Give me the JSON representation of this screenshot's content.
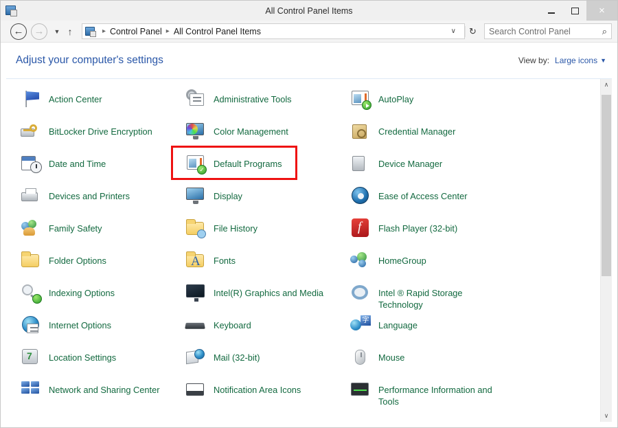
{
  "window": {
    "title": "All Control Panel Items",
    "icon": "control-panel-icon",
    "controls": {
      "minimize": "–",
      "maximize": "□",
      "close": "×"
    }
  },
  "addressbar": {
    "back_icon": "←",
    "forward_icon": "→",
    "history_caret": "▼",
    "up_icon": "↑",
    "crumb_icon": "control-panel-icon",
    "separator": "▸",
    "crumbs": [
      "Control Panel",
      "All Control Panel Items"
    ],
    "dropdown_caret": "∨",
    "refresh_icon": "↻",
    "search": {
      "value": "",
      "placeholder": "Search Control Panel",
      "icon": "⌕"
    }
  },
  "header": {
    "page_title": "Adjust your computer's settings",
    "viewby_label": "View by:",
    "viewby_value": "Large icons",
    "viewby_caret": "▼"
  },
  "highlight": {
    "target": "Default Programs",
    "color": "#ee1111"
  },
  "colors": {
    "item_label": "#12693f",
    "page_title": "#2a57a8",
    "link": "#2a57a8",
    "titlebar_bg": "#f0f0f0",
    "highlight_red": "#ee1111"
  },
  "scrollbar": {
    "up_arrow": "∧",
    "down_arrow": "∨"
  },
  "items": [
    {
      "label": "Action Center",
      "icon": "action-center-icon",
      "art": "action-center"
    },
    {
      "label": "Administrative Tools",
      "icon": "administrative-tools-icon",
      "art": "administrative-tools"
    },
    {
      "label": "AutoPlay",
      "icon": "autoplay-icon",
      "art": "autoplay"
    },
    {
      "label": "BitLocker Drive Encryption",
      "icon": "bitlocker-icon",
      "art": "bitlocker"
    },
    {
      "label": "Color Management",
      "icon": "color-management-icon",
      "art": "color-management"
    },
    {
      "label": "Credential Manager",
      "icon": "credential-manager-icon",
      "art": "credential-manager"
    },
    {
      "label": "Date and Time",
      "icon": "date-and-time-icon",
      "art": "date-and-time"
    },
    {
      "label": "Default Programs",
      "icon": "default-programs-icon",
      "art": "default-programs"
    },
    {
      "label": "Device Manager",
      "icon": "device-manager-icon",
      "art": "device-manager"
    },
    {
      "label": "Devices and Printers",
      "icon": "devices-and-printers-icon",
      "art": "devices-and-printers"
    },
    {
      "label": "Display",
      "icon": "display-icon",
      "art": "display"
    },
    {
      "label": "Ease of Access Center",
      "icon": "ease-of-access-icon",
      "art": "ease-of-access"
    },
    {
      "label": "Family Safety",
      "icon": "family-safety-icon",
      "art": "family-safety"
    },
    {
      "label": "File History",
      "icon": "file-history-icon",
      "art": "file-history"
    },
    {
      "label": "Flash Player (32-bit)",
      "icon": "flash-player-icon",
      "art": "flash-player"
    },
    {
      "label": "Folder Options",
      "icon": "folder-options-icon",
      "art": "folder-options"
    },
    {
      "label": "Fonts",
      "icon": "fonts-icon",
      "art": "fonts"
    },
    {
      "label": "HomeGroup",
      "icon": "homegroup-icon",
      "art": "homegroup"
    },
    {
      "label": "Indexing Options",
      "icon": "indexing-options-icon",
      "art": "indexing-options"
    },
    {
      "label": "Intel(R) Graphics and Media",
      "icon": "intel-graphics-icon",
      "art": "intel-graphics"
    },
    {
      "label": "Intel ® Rapid Storage Technology",
      "icon": "intel-rapid-storage-icon",
      "art": "intel-rapid-storage"
    },
    {
      "label": "Internet Options",
      "icon": "internet-options-icon",
      "art": "internet-options"
    },
    {
      "label": "Keyboard",
      "icon": "keyboard-icon",
      "art": "keyboard"
    },
    {
      "label": "Language",
      "icon": "language-icon",
      "art": "language"
    },
    {
      "label": "Location Settings",
      "icon": "location-settings-icon",
      "art": "location-settings"
    },
    {
      "label": "Mail (32-bit)",
      "icon": "mail-icon",
      "art": "mail"
    },
    {
      "label": "Mouse",
      "icon": "mouse-icon",
      "art": "mouse"
    },
    {
      "label": "Network and Sharing Center",
      "icon": "network-sharing-icon",
      "art": "network-sharing"
    },
    {
      "label": "Notification Area Icons",
      "icon": "notification-area-icon",
      "art": "notification-area"
    },
    {
      "label": "Performance Information and Tools",
      "icon": "performance-info-icon",
      "art": "performance-info"
    }
  ]
}
